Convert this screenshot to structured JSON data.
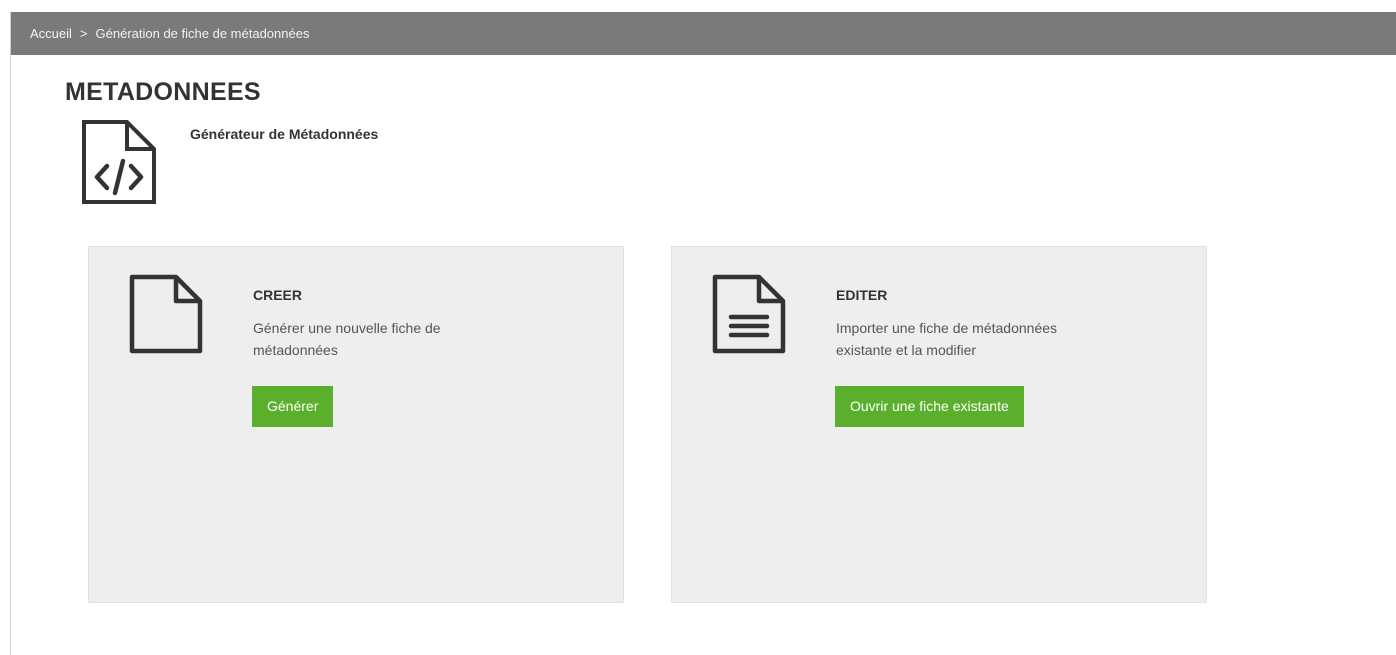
{
  "breadcrumb": {
    "home": "Accueil",
    "separator": ">",
    "current": "Génération de fiche de métadonnées"
  },
  "page": {
    "title": "METADONNEES",
    "app_icon": "code-file-icon",
    "subtitle": "Générateur de Métadonnées"
  },
  "cards": {
    "create": {
      "icon": "blank-file-icon",
      "title": "CREER",
      "description": "Générer une nouvelle fiche de métadonnées",
      "button_label": "Générer"
    },
    "edit": {
      "icon": "text-file-icon",
      "title": "EDITER",
      "description": "Importer une fiche de métadonnées existante et la modifier",
      "button_label": "Ouvrir une fiche existante"
    }
  },
  "colors": {
    "breadcrumb_bg": "#7a7a7a",
    "card_bg": "#eeeeee",
    "button_green": "#5ab02c",
    "text_dark": "#333333"
  }
}
